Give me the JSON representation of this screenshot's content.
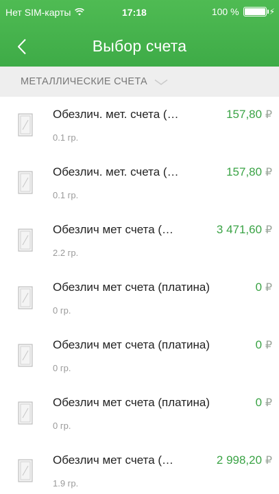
{
  "status_bar": {
    "carrier": "Нет SIM-карты",
    "time": "17:18",
    "battery": "100 %"
  },
  "nav": {
    "title": "Выбор счета"
  },
  "section": {
    "label": "МЕТАЛЛИЧЕСКИЕ СЧЕТА"
  },
  "accounts": [
    {
      "name": "Обезлич. мет. счета (…",
      "amount": "157,80",
      "currency": "₽",
      "weight": "0.1 гр."
    },
    {
      "name": "Обезлич. мет. счета (…",
      "amount": "157,80",
      "currency": "₽",
      "weight": "0.1 гр."
    },
    {
      "name": "Обезлич мет счета (…",
      "amount": "3 471,60",
      "currency": "₽",
      "weight": "2.2 гр."
    },
    {
      "name": "Обезлич мет счета (платина)",
      "amount": "0",
      "currency": "₽",
      "weight": "0 гр."
    },
    {
      "name": "Обезлич мет счета (платина)",
      "amount": "0",
      "currency": "₽",
      "weight": "0 гр."
    },
    {
      "name": "Обезлич мет счета (платина)",
      "amount": "0",
      "currency": "₽",
      "weight": "0 гр."
    },
    {
      "name": "Обезлич мет счета (…",
      "amount": "2 998,20",
      "currency": "₽",
      "weight": "1.9 гр."
    }
  ],
  "colors": {
    "header": "#45b24d",
    "amount": "#3aa345"
  },
  "icons": {
    "wifi": "wifi-icon",
    "back": "back-chevron-icon",
    "section_toggle": "chevron-down-icon",
    "account": "metal-bar-icon"
  }
}
